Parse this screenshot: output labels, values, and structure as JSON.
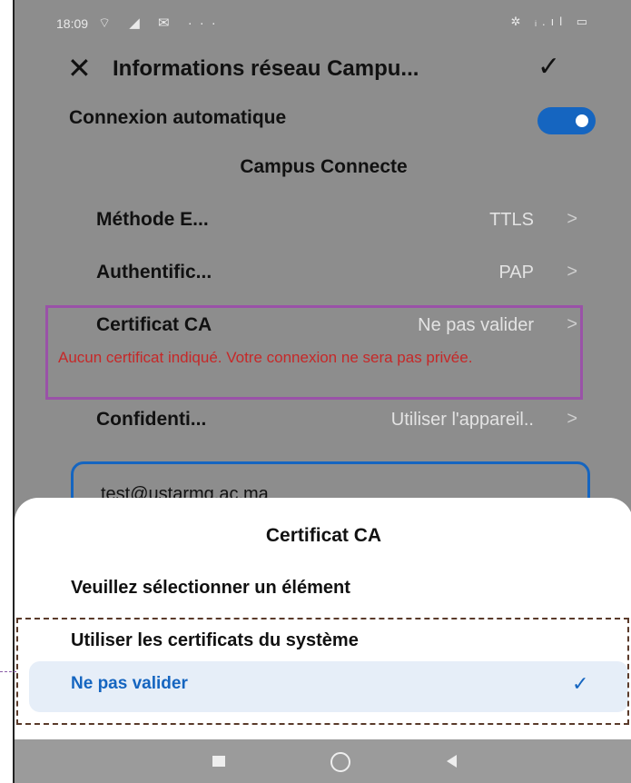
{
  "status_bar": {
    "time": "18:09",
    "left_icons": "⌔ ◢ ✉ ···",
    "right_icons": "✲ ᵢ.ıl ▭"
  },
  "toolbar": {
    "close_icon": "close-icon",
    "title": "Informations réseau Campu...",
    "confirm_icon": "checkmark-icon"
  },
  "auto_connect": {
    "label": "Connexion automatique",
    "enabled": true
  },
  "network_name": "Campus Connecte",
  "settings": {
    "eap_method": {
      "label": "Méthode E...",
      "value": "TTLS"
    },
    "authentication": {
      "label": "Authentific...",
      "value": "PAP"
    },
    "ca_certificate": {
      "label": "Certificat CA",
      "value": "Ne pas valider",
      "error": "Aucun certificat indiqué. Votre connexion ne sera pas privée."
    },
    "privacy": {
      "label": "Confidenti...",
      "value": "Utiliser l'appareil.."
    }
  },
  "identity_field": {
    "value": "test@ustarmg.ac.ma"
  },
  "chevron": ">",
  "sheet": {
    "title": "Certificat CA",
    "prompt": "Veuillez sélectionner un élément",
    "options": [
      {
        "label": "Utiliser les certificats du système",
        "selected": false
      },
      {
        "label": "Ne pas valider",
        "selected": true
      }
    ],
    "selected_mark": "✓"
  },
  "colors": {
    "accent": "#1565c0",
    "error": "#c62828",
    "highlight_border": "#9a52a8",
    "dim_overlay": "#8d8d8d"
  }
}
